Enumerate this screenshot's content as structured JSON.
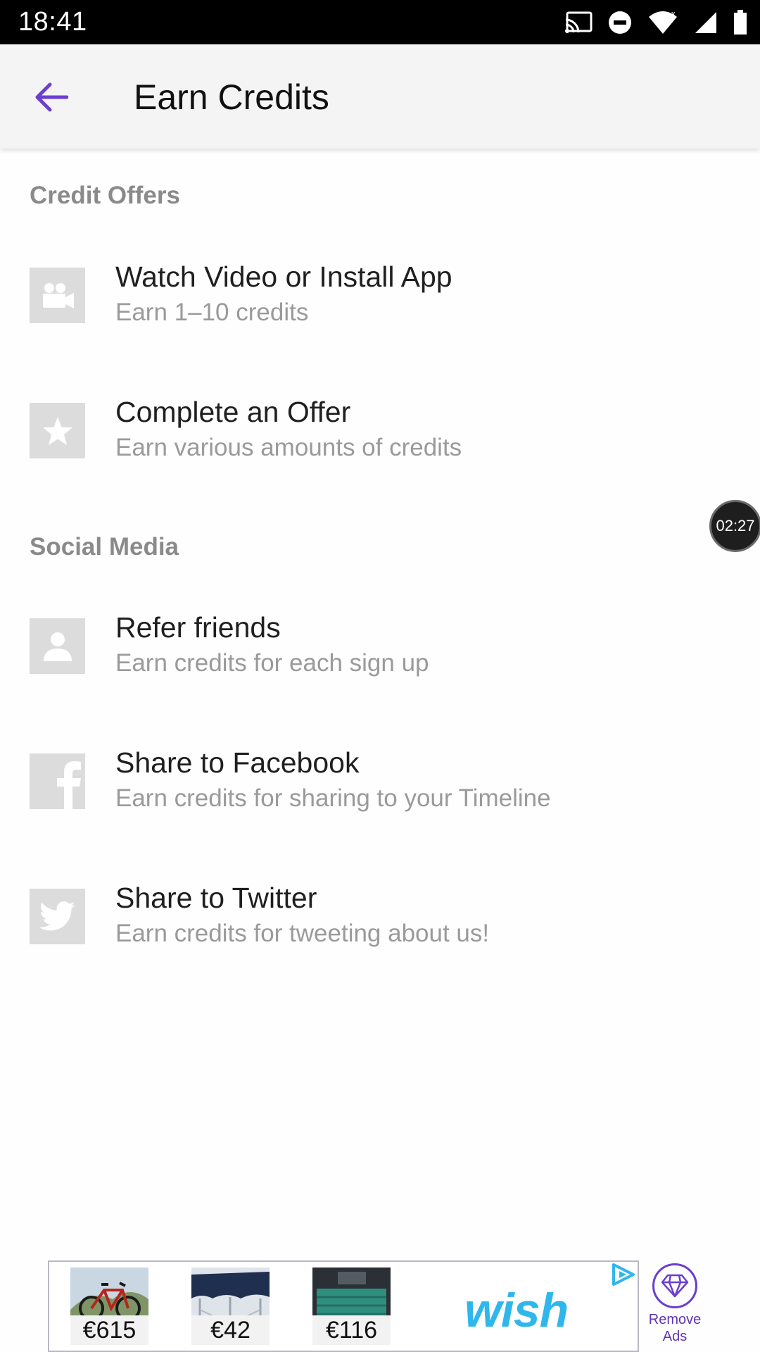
{
  "status_bar": {
    "time": "18:41"
  },
  "app_bar": {
    "title": "Earn Credits"
  },
  "sections": [
    {
      "header": "Credit Offers",
      "items": [
        {
          "icon": "video-camera-icon",
          "title": "Watch Video or Install App",
          "subtitle": "Earn 1–10 credits"
        },
        {
          "icon": "star-icon",
          "title": "Complete an Offer",
          "subtitle": "Earn various amounts of credits"
        }
      ]
    },
    {
      "header": "Social Media",
      "items": [
        {
          "icon": "person-icon",
          "title": "Refer friends",
          "subtitle": "Earn credits for each sign up"
        },
        {
          "icon": "facebook-icon",
          "title": "Share to Facebook",
          "subtitle": "Earn credits for sharing to your Timeline"
        },
        {
          "icon": "twitter-icon",
          "title": "Share to Twitter",
          "subtitle": "Earn credits for tweeting about us!"
        }
      ]
    }
  ],
  "timer": {
    "value": "02:27"
  },
  "ad": {
    "brand": "wish",
    "products": [
      {
        "price": "€615"
      },
      {
        "price": "€42"
      },
      {
        "price": "€116"
      }
    ]
  },
  "remove_ads": {
    "label": "Remove Ads"
  },
  "colors": {
    "accent": "#6a3fcf",
    "icon_bg": "#dcdcdc",
    "subtitle": "#9a9a9a",
    "section_header": "#8a8a8a",
    "wish": "#2fb7ec"
  }
}
